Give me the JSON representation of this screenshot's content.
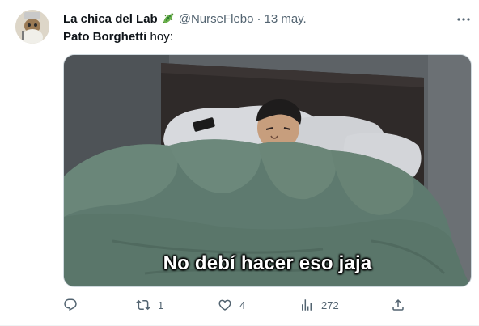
{
  "tweet": {
    "author": {
      "display_name": "La chica del Lab",
      "name_emoji": "microbe-emoji",
      "handle": "@NurseFlebo",
      "separator": "·",
      "date": "13 may."
    },
    "text": {
      "mention": "Pato Borghetti",
      "rest": " hoy:"
    },
    "media": {
      "caption": "No debí hacer eso jaja"
    },
    "actions": {
      "reply_icon": "reply-icon",
      "retweet_icon": "retweet-icon",
      "retweet_count": "1",
      "like_icon": "heart-icon",
      "like_count": "4",
      "views_icon": "views-icon",
      "views_count": "272",
      "share_icon": "share-icon"
    },
    "more_icon": "more-icon"
  },
  "colors": {
    "text_primary": "#0f1419",
    "text_secondary": "#536471",
    "border": "#cfd9de"
  }
}
